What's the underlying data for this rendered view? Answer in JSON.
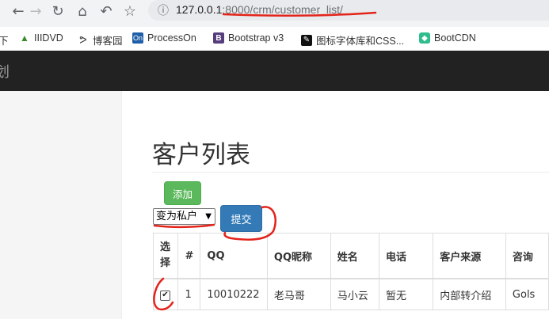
{
  "browser": {
    "url_host": "127.0.0.1",
    "url_rest": ":8000/crm/customer_list/",
    "bookmarks": [
      {
        "label": "下",
        "icon": ""
      },
      {
        "label": "IIIDVD",
        "icon": "triangle-icon"
      },
      {
        "label": "博客园",
        "icon": "cnblogs-icon"
      },
      {
        "label": "ProcessOn",
        "icon": "On"
      },
      {
        "label": "Bootstrap v3",
        "icon": "B"
      },
      {
        "label": "图标字体库和CSS...",
        "icon": "iconfont-icon"
      },
      {
        "label": "BootCDN",
        "icon": "bootcdn-icon"
      }
    ]
  },
  "navbar": {
    "brand": "划"
  },
  "page": {
    "title": "客户列表",
    "add_label": "添加",
    "action_select": "变为私户",
    "submit_label": "提交"
  },
  "table": {
    "headers": [
      "选\n择",
      "#",
      "QQ",
      "QQ昵称",
      "姓名",
      "电话",
      "客户来源",
      "咨询"
    ],
    "rows": [
      {
        "checked": true,
        "num": "1",
        "qq": "10010222",
        "nick": "老马哥",
        "name": "马小云",
        "phone": "暂无",
        "source": "内部转介绍",
        "consult": "Gols"
      }
    ]
  },
  "colors": {
    "annotation": "#e3241b",
    "primary": "#337ab7",
    "success": "#5cb85c",
    "navbar": "#222222"
  }
}
